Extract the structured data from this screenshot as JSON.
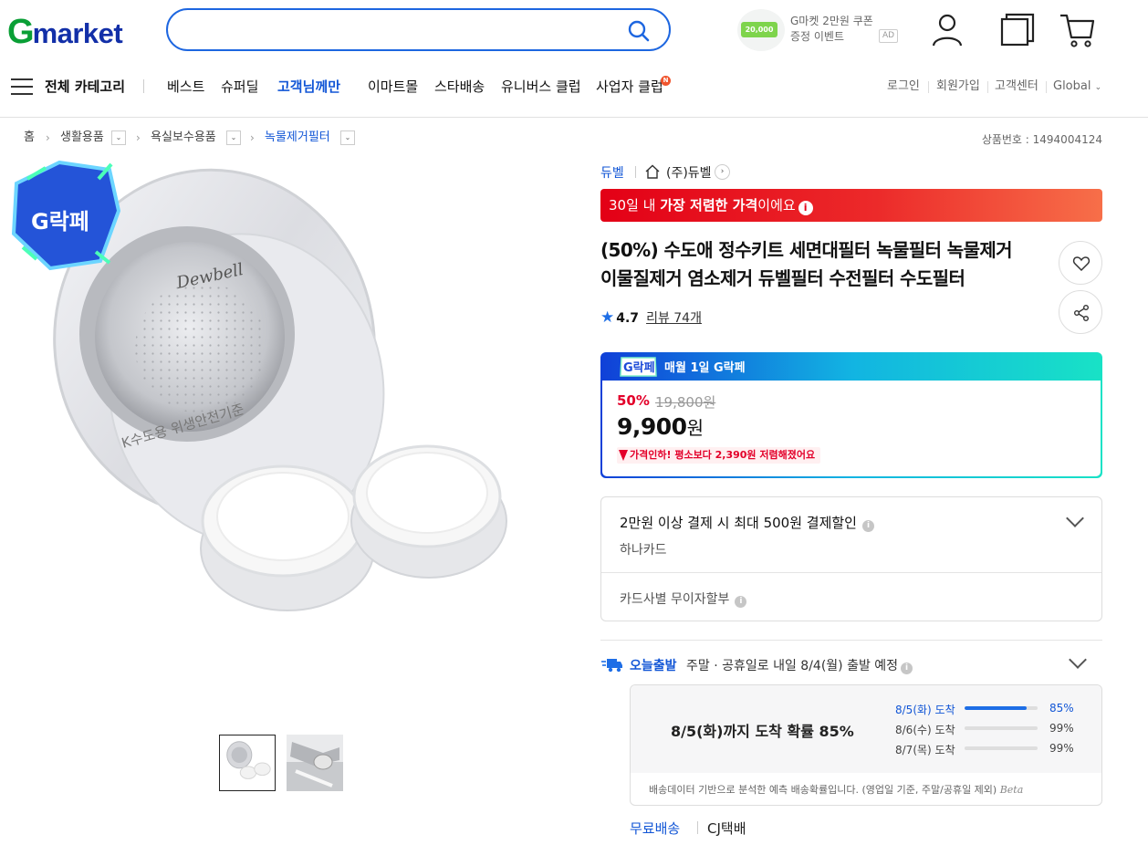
{
  "header": {
    "logo_g": "G",
    "logo_rest": "market",
    "search": {
      "value": "",
      "placeholder": ""
    },
    "coupon": {
      "amount": "20,000",
      "line1": "G마켓 2만원 쿠폰",
      "line2": "증정 이벤트",
      "ad": "AD"
    },
    "icons": [
      "user-icon",
      "recent-items-icon",
      "cart-icon"
    ]
  },
  "nav": {
    "menu_label": "전체 카테고리",
    "links": [
      {
        "label": "베스트",
        "highlight": false
      },
      {
        "label": "슈퍼딜",
        "highlight": false
      },
      {
        "label": "고객님께만",
        "highlight": true
      },
      {
        "label": "이마트몰",
        "highlight": false
      },
      {
        "label": "스타배송",
        "highlight": false
      },
      {
        "label": "유니버스 클럽",
        "highlight": false
      },
      {
        "label": "사업자 클럽",
        "highlight": false
      }
    ],
    "new_badge": "N",
    "util": [
      "로그인",
      "회원가입",
      "고객센터",
      "Global"
    ]
  },
  "breadcrumb": {
    "items": [
      "홈",
      "생활용품",
      "욕실보수용품",
      "녹물제거필터"
    ],
    "product_number": "상품번호 : 1494004124"
  },
  "product": {
    "brand": "듀벨",
    "shop": "(주)듀벨",
    "lowest_banner": {
      "pre": "30일 내 ",
      "bold": "가장 저렴한 가격",
      "post": "이에요"
    },
    "title": "(50%) 수도애 정수키트 세면대필터 녹물필터 녹물제거 이물질제거 염소제거 듀벨필터 수전필터 수도필터",
    "rating": "4.7",
    "review": "리뷰 74개",
    "image_text": {
      "badge": "G락페",
      "brand_mark": "Dewbell",
      "label": "K수도용 위생안전기준"
    }
  },
  "price": {
    "promo_badge": "G락페",
    "promo_label": "매월 1일 G락페",
    "discount": "50%",
    "original": "19,800원",
    "sale": "9,900",
    "won": "원",
    "drop_notice": "가격인하! 평소보다 2,390원 저렴해졌어요"
  },
  "card": {
    "title": "2만원 이상 결제 시 최대 500원 결제할인",
    "sub": "하나카드",
    "installment": "카드사별 무이자할부"
  },
  "shipping": {
    "today": "오늘출발",
    "info": "주말 · 공휴일로 내일 8/4(월) 출발 예정",
    "probability_main": "8/5(화)까지 도착 확률 85%",
    "rows": [
      {
        "label": "8/5(화) 도착",
        "pct": "85%",
        "value": 0.85,
        "highlight": true
      },
      {
        "label": "8/6(수) 도착",
        "pct": "99%",
        "value": 0.99,
        "highlight": false
      },
      {
        "label": "8/7(목) 도착",
        "pct": "99%",
        "value": 0.99,
        "highlight": false
      }
    ],
    "footnote": "배송데이터 기반으로 분석한 예측 배송확률입니다. (영업일 기준, 주말/공휴일 제외)",
    "beta": "Beta",
    "free": "무료배송",
    "courier": "CJ택배"
  },
  "colors": {
    "brand_blue": "#1256d6",
    "logo_green": "#0a9f36",
    "sale_red": "#e3002a"
  }
}
